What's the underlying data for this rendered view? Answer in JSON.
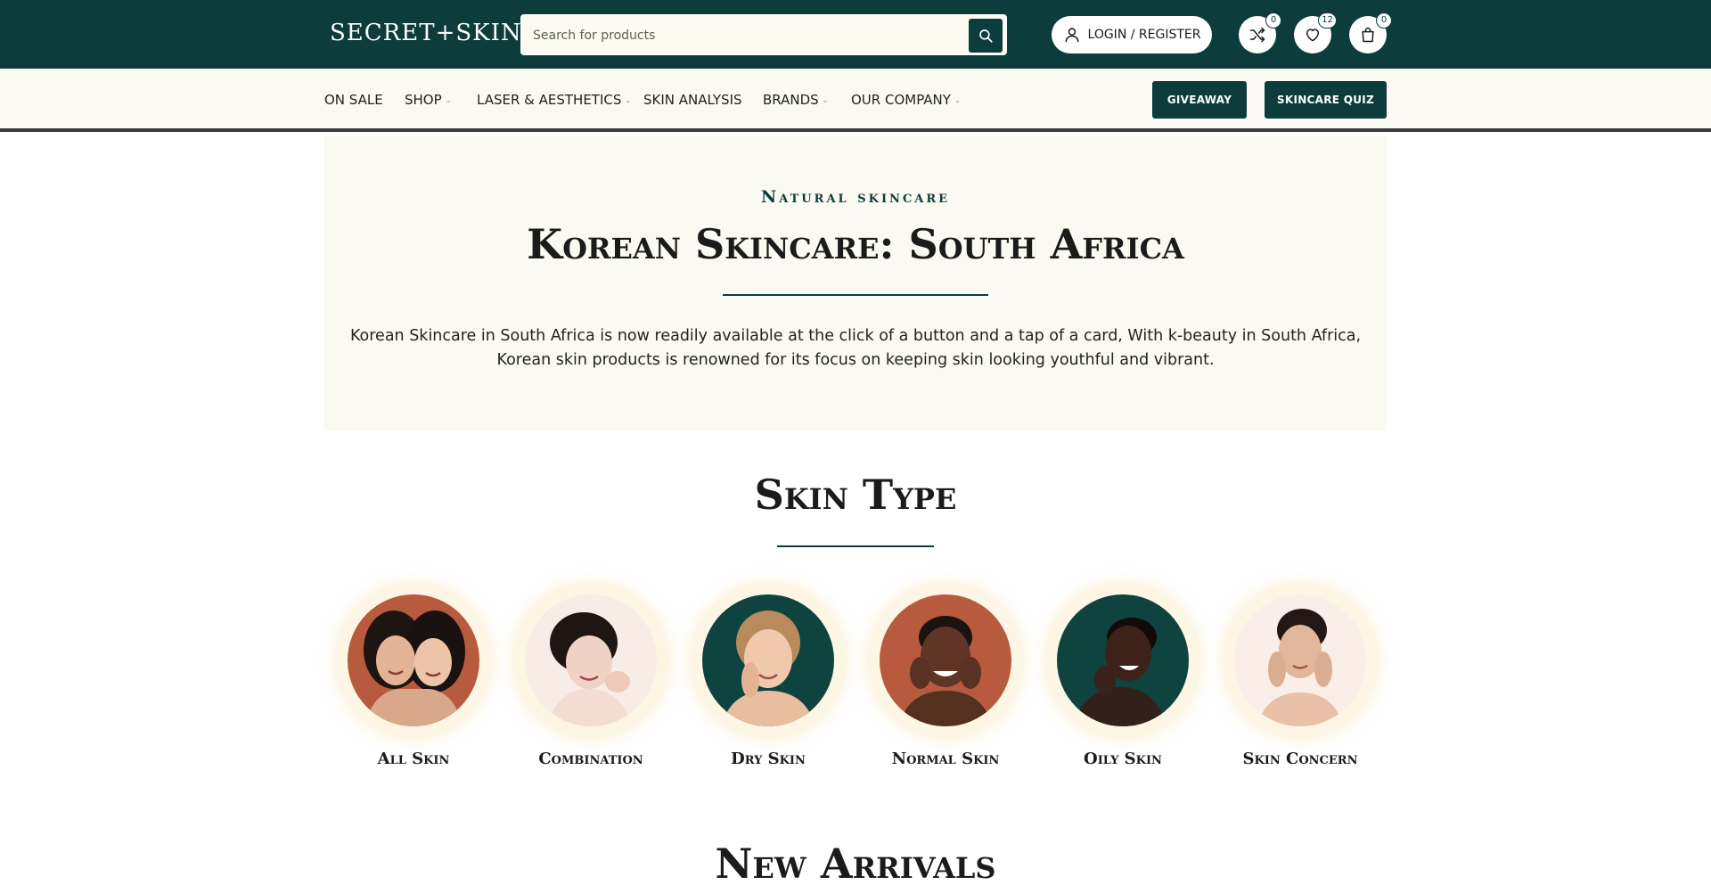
{
  "header": {
    "logo": "SECRET+SKIN",
    "search": {
      "placeholder": "Search for products",
      "value": ""
    },
    "login_label": "LOGIN / REGISTER",
    "compare_count": "0",
    "wishlist_count": "12",
    "cart_count": "0",
    "icons": [
      "search-icon",
      "user-icon",
      "shuffle-icon",
      "heart-icon",
      "bag-icon"
    ]
  },
  "nav": {
    "items": [
      {
        "label": "ON SALE",
        "has_dropdown": false
      },
      {
        "label": "SHOP",
        "has_dropdown": true
      },
      {
        "label": "LASER & AESTHETICS",
        "has_dropdown": true
      },
      {
        "label": "SKIN ANALYSIS",
        "has_dropdown": false
      },
      {
        "label": "BRANDS",
        "has_dropdown": true
      },
      {
        "label": "OUR COMPANY",
        "has_dropdown": true
      }
    ],
    "giveaway_label": "GIVEAWAY",
    "quiz_label": "SKINCARE QUIZ"
  },
  "hero": {
    "eyebrow": "Natural skincare",
    "title": "Korean Skincare: South Africa",
    "text": "Korean Skincare in South Africa is now readily available at the click of a button and a tap of a card, With k-beauty in South Africa, Korean skin products is renowned for its focus on keeping skin looking youthful and vibrant."
  },
  "skin_type": {
    "title": "Skin Type",
    "items": [
      {
        "label": "All Skin"
      },
      {
        "label": "Combination"
      },
      {
        "label": "Dry Skin"
      },
      {
        "label": "Normal Skin"
      },
      {
        "label": "Oily Skin"
      },
      {
        "label": "Skin Concern"
      }
    ]
  },
  "new_arrivals": {
    "title": "New Arrivals"
  },
  "colors": {
    "brand_teal": "#0c3d3c",
    "cream": "#fbfaf2",
    "terracotta": "#b85a3e"
  }
}
